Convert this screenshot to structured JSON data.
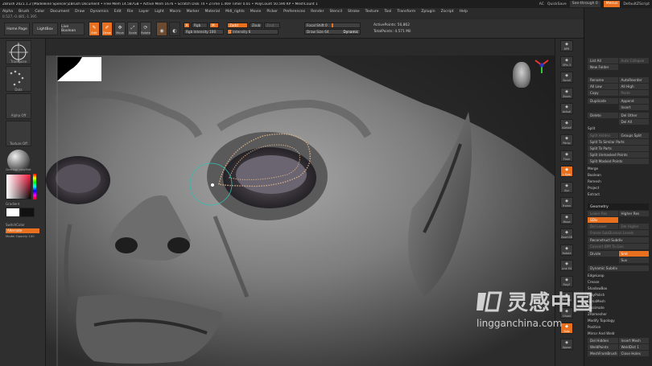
{
  "titlebar": {
    "title": "ZBrush 2021.1.2 [Madeleine Spencer]ZBrush Document  • Free Mem 14.587GB • Active Mem 1676 • Scratch Disk 74 • ZTime 1.469 Timer 0.01 • PolyCount 50.590 KP • MeshCount 1",
    "ac": "AC",
    "quicksave": "QuickSave",
    "seethrough": "See-through  0",
    "menus_btn": "Menus",
    "defaultzscript": "DefaultZScript"
  },
  "menubar": [
    "Alpha",
    "Brush",
    "Color",
    "Document",
    "Draw",
    "Dynamics",
    "Edit",
    "File",
    "Layer",
    "Light",
    "Macro",
    "Marker",
    "Material",
    "Mdl_rights",
    "Movie",
    "Picker",
    "Preferences",
    "Render",
    "Stencil",
    "Stroke",
    "Texture",
    "Tool",
    "Transform",
    "Zplugin",
    "Zscript",
    "Help"
  ],
  "coords": "0.527,-0.485,-1.395",
  "toolbar": {
    "home_page": "Home Page",
    "lightbox": "LightBox",
    "live_boolean": "Live Boolean",
    "icons": [
      {
        "icon": "edit-icon",
        "label": "Edit",
        "active": true
      },
      {
        "icon": "draw-icon",
        "label": "Draw",
        "active": true
      },
      {
        "icon": "move-icon",
        "label": "Move",
        "active": false
      },
      {
        "icon": "scale-icon",
        "label": "Scale",
        "active": false
      },
      {
        "icon": "rotate-icon",
        "label": "Rotate",
        "active": false
      }
    ],
    "mrgb": "A",
    "rgb": "Rgb",
    "m": "M",
    "zadd": "Zadd",
    "zsub": "Zsub",
    "zcut": "Zcut",
    "rgb_intensity": "Rgb Intensity  100",
    "z_intensity": "Z Intensity  6",
    "focal_shift": "Focal Shift  0",
    "draw_size": "Draw Size  64",
    "dynamic": "Dynamic",
    "active_points": "ActivePoints: 56,862",
    "total_points": "TotalPoints: 4.571 Mil"
  },
  "leftpanel": {
    "brush_label": "Transpose",
    "stroke_label": "Dots",
    "alpha_label": "Alpha Off",
    "texture_label": "Texture Off",
    "material_label": "DustingCrabyMat",
    "gradient": "Gradient",
    "switch_color": "SwitchColor",
    "alternate": "Alternate",
    "model_opacity": "Model Opacity 100"
  },
  "rightshelf": [
    {
      "icon": "bpr-icon",
      "label": "BPR"
    },
    {
      "icon": "spix-icon",
      "label": "SPix 3"
    },
    {
      "icon": "scroll-icon",
      "label": "Scroll"
    },
    {
      "icon": "zoom-icon",
      "label": "Zoom"
    },
    {
      "icon": "actual-icon",
      "label": "Actual"
    },
    {
      "icon": "aahalf-icon",
      "label": "AAHalf"
    },
    {
      "icon": "persp-icon",
      "label": "Persp"
    },
    {
      "icon": "floor-icon",
      "label": "Floor"
    },
    {
      "icon": "lsym-icon",
      "label": "L.Sym"
    },
    {
      "icon": "xyz-icon",
      "label": "Xyz"
    },
    {
      "icon": "frame-icon",
      "label": "Frame"
    },
    {
      "icon": "move-icon",
      "label": "Move"
    },
    {
      "icon": "zoom3d-icon",
      "label": "Zoom3D"
    },
    {
      "icon": "rotate-icon",
      "label": "Rotate"
    },
    {
      "icon": "linefill-icon",
      "label": "Line Fill"
    },
    {
      "icon": "polyf-icon",
      "label": "PolyF"
    },
    {
      "icon": "transp-icon",
      "label": "Transp"
    },
    {
      "icon": "ghost-icon",
      "label": "Ghost"
    },
    {
      "icon": "solo-icon",
      "label": "Solo"
    },
    {
      "icon": "xpose-icon",
      "label": "Xpose"
    }
  ],
  "subtool": {
    "list_all": "List All",
    "auto_collapse": "Auto Collapse",
    "new_folder": "New Folder",
    "rename": "Rename",
    "auto_reorder": "AutoReorder",
    "all_low": "All Low",
    "all_high": "All High",
    "copy": "Copy",
    "paste": "Paste",
    "append": "Append",
    "duplicate": "Duplicate",
    "insert": "Insert",
    "delete": "Delete",
    "del_other": "Del Other",
    "del_all": "Del All",
    "split_header": "Split",
    "split_hidden": "Split Hidden",
    "groups_split": "Groups Split",
    "split_similar": "Split To Similar Parts",
    "split_parts": "Split To Parts",
    "split_unmasked": "Split Unmasked Points",
    "split_masked": "Split Masked Points",
    "merge": "Merge",
    "boolean": "Boolean",
    "remesh": "Remesh",
    "project": "Project",
    "extract": "Extract"
  },
  "geometry": {
    "header": "Geometry",
    "lower_res": "Lower Res",
    "higher_res": "Higher Res",
    "sdiv": "SDiv",
    "del_lower": "Del Lower",
    "del_higher": "Del Higher",
    "freeze": "Freeze SubDivision Levels",
    "reconstruct": "Reconstruct Subdiv",
    "convert_bpr": "Convert BPR To Geo",
    "divide": "Divide",
    "smt": "Smt",
    "suv": "Suv",
    "reuv": "ReUV",
    "dynamic_subdiv": "Dynamic Subdiv",
    "edgeloop": "EdgeLoop",
    "crease": "Crease",
    "shadowbox": "ShadowBox",
    "claypolish": "ClayPolish",
    "dynamesh": "DynaMesh",
    "tessimate": "Tessimate",
    "zremesher": "ZRemesher",
    "modify_topology": "Modify Topology",
    "position": "Position",
    "size": "Size",
    "meshintegrity": "MeshIntegrity",
    "array_mesh": "ArrayMesh",
    "nanomesh": "NanoMesh",
    "layers": "Layers",
    "fibermesh": "FiberMesh",
    "geometry_hd": "Geometry HD",
    "preview": "Preview",
    "surface": "Surface",
    "deformation": "Deformation",
    "mirror_weld": "Mirror And Weld",
    "del_hidden": "Del Hidden",
    "insert_mesh": "Insert Mesh",
    "weldpoints": "WeldPoints",
    "weld_dist": "WeldDist 1",
    "meshfromb": "MeshFromBrush",
    "close_holes": "Close Holes"
  },
  "watermark": {
    "cn": "灵感中国",
    "site": "lingganchina.com"
  }
}
